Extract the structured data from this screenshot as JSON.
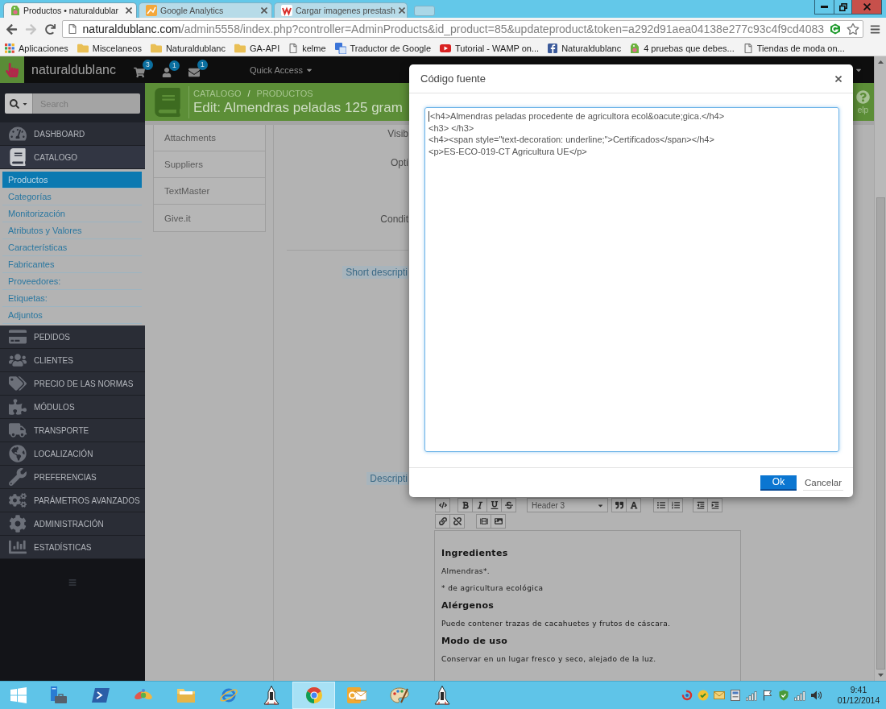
{
  "browser": {
    "tabs": [
      {
        "title": "Productos • naturaldublar",
        "selected": true
      },
      {
        "title": "Google Analytics",
        "selected": false
      },
      {
        "title": "Cargar imagenes prestash",
        "selected": false
      }
    ],
    "nav_buttons": [
      {
        "disabled": false
      },
      {
        "disabled": true
      }
    ],
    "address": {
      "host": "naturaldublanc.com",
      "path": "/admin5558/index.php?controller=AdminProducts&id_product=85&updateproduct&token=a292d91aea04138e277c93c4f9cd4083"
    },
    "bookmarks": [
      {
        "kind": "apps",
        "label": "Aplicaciones"
      },
      {
        "kind": "folder",
        "label": "Miscelaneos"
      },
      {
        "kind": "folder",
        "label": "Naturaldublanc"
      },
      {
        "kind": "folder",
        "label": "GA-API"
      },
      {
        "kind": "link",
        "label": "kelme"
      },
      {
        "kind": "link",
        "label": "Traductor de Google"
      },
      {
        "kind": "link",
        "label": "Tutorial - WAMP on..."
      },
      {
        "kind": "link",
        "label": "Naturaldublanc"
      },
      {
        "kind": "link",
        "label": "4 pruebas que debes..."
      },
      {
        "kind": "link",
        "label": "Tiendas de moda on..."
      }
    ]
  },
  "admin_bar": {
    "shop_name": "naturaldublanc",
    "notifications": [
      {
        "count": "3"
      },
      {
        "count": "1"
      },
      {
        "count": "1"
      }
    ],
    "quick_access": "Quick Access"
  },
  "sidebar": {
    "search": {
      "placeholder": "Search"
    },
    "items": [
      {
        "label": "DASHBOARD",
        "expanded": false
      },
      {
        "label": "CATALOGO",
        "expanded": true,
        "children": [
          {
            "label": "Productos",
            "selected": true
          },
          {
            "label": "Categorías",
            "selected": false
          },
          {
            "label": "Monitorización",
            "selected": false
          },
          {
            "label": "Atributos y Valores",
            "selected": false
          },
          {
            "label": "Características",
            "selected": false
          },
          {
            "label": "Fabricantes",
            "selected": false
          },
          {
            "label": "Proveedores:",
            "selected": false
          },
          {
            "label": "Etiquetas:",
            "selected": false
          },
          {
            "label": "Adjuntos",
            "selected": false
          }
        ]
      },
      {
        "label": "PEDIDOS",
        "expanded": false
      },
      {
        "label": "CLIENTES",
        "expanded": false
      },
      {
        "label": "PRECIO DE LAS NORMAS",
        "expanded": false
      },
      {
        "label": "MÓDULOS",
        "expanded": false
      },
      {
        "label": "TRANSPORTE",
        "expanded": false
      },
      {
        "label": "LOCALIZACIÓN",
        "expanded": false
      },
      {
        "label": "PREFERENCIAS",
        "expanded": false
      },
      {
        "label": "PARÁMETROS AVANZADOS",
        "expanded": false
      },
      {
        "label": "ADMINISTRACIÓN",
        "expanded": false
      },
      {
        "label": "ESTADÍSTICAS",
        "expanded": false
      }
    ]
  },
  "page_header": {
    "breadcrumb": [
      "CATALOGO",
      "PRODUCTOS"
    ],
    "separator": "/",
    "title": "Edit: Almendras peladas 125 gram",
    "help": "elp"
  },
  "product_tabs": [
    {
      "label": "Attachments",
      "selected": false
    },
    {
      "label": "Suppliers",
      "selected": false
    },
    {
      "label": "TextMaster",
      "selected": false
    },
    {
      "label": "Give.it",
      "selected": false
    }
  ],
  "form": {
    "labels": [
      {
        "kind": "plain",
        "text": "Visib"
      },
      {
        "kind": "plain",
        "text": "Opti"
      },
      {
        "kind": "plain",
        "text": "Condit"
      },
      {
        "kind": "hint",
        "text": "Short descripti"
      },
      {
        "kind": "hint",
        "text": "Descripti"
      }
    ]
  },
  "editor": {
    "heading_style": "Header 3",
    "content": [
      {
        "kind": "heading",
        "text": "Ingredientes"
      },
      {
        "kind": "paragraph",
        "text": "Almendras*."
      },
      {
        "kind": "paragraph",
        "text": "* de agricultura ecológica"
      },
      {
        "kind": "heading",
        "text": "Alérgenos"
      },
      {
        "kind": "paragraph",
        "text": "Puede contener trazas de cacahuetes y frutos de cáscara."
      },
      {
        "kind": "heading",
        "text": "Modo de uso"
      },
      {
        "kind": "paragraph",
        "text": "Conservar en un lugar fresco y seco, alejado de la luz."
      }
    ]
  },
  "dialog": {
    "title": "Código fuente",
    "code_lines": [
      "<h4>Almendras peladas procedente de agricultora ecol&oacute;gica.</h4>",
      "<h3> </h3>",
      "<h4><span style=\"text-decoration: underline;\">Certificados</span></h4>",
      "<p>ES-ECO-019-CT Agricultura UE</p>"
    ],
    "buttons": [
      {
        "kind": "primary",
        "label": "Ok"
      },
      {
        "kind": "link",
        "label": "Cancelar"
      }
    ]
  },
  "taskbar": {
    "apps": [
      {
        "selected": false
      },
      {
        "selected": false
      },
      {
        "selected": false
      },
      {
        "selected": false
      },
      {
        "selected": false
      },
      {
        "selected": false
      },
      {
        "selected": true
      },
      {
        "selected": false
      },
      {
        "selected": false
      },
      {
        "selected": false
      }
    ],
    "clock": {
      "time": "9:41",
      "date": "01/12/2014"
    }
  }
}
